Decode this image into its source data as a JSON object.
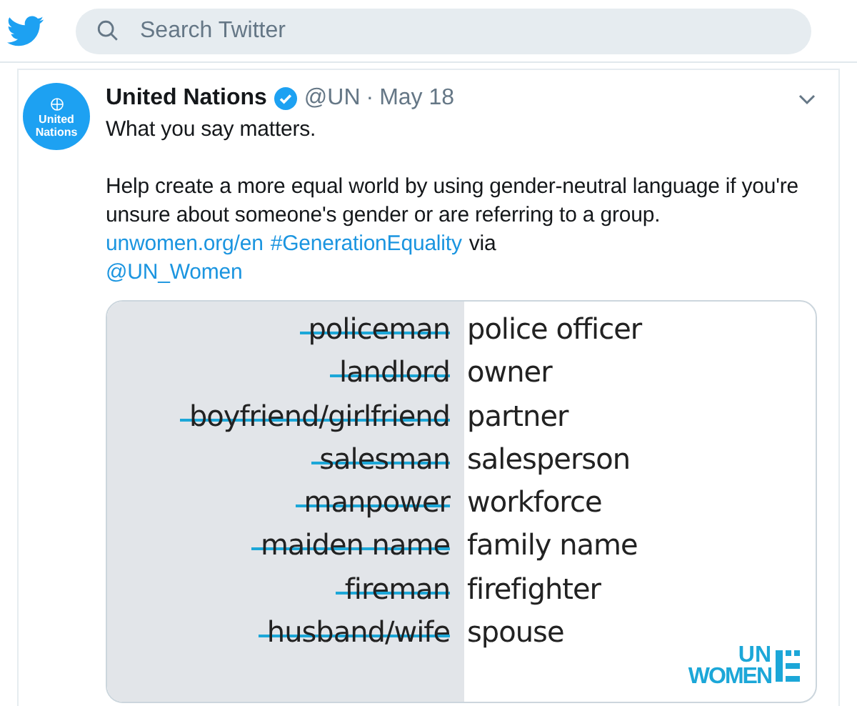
{
  "search": {
    "placeholder": "Search Twitter"
  },
  "tweet": {
    "avatar_text": "United Nations",
    "name": "United Nations",
    "verified": true,
    "handle": "@UN",
    "separator": "·",
    "date": "May 18",
    "lines": [
      "What you say matters.",
      "Help create a more equal world by using gender-neutral language if you're unsure about someone's gender or are referring to a group."
    ],
    "link": "unwomen.org/en",
    "hashtag": "#GenerationEquality",
    "via": "via",
    "mention": "@UN_Women",
    "image": {
      "pairs": [
        {
          "avoid": "policeman",
          "use": "police officer"
        },
        {
          "avoid": "landlord",
          "use": "owner"
        },
        {
          "avoid": "boyfriend/girlfriend",
          "use": "partner"
        },
        {
          "avoid": "salesman",
          "use": "salesperson"
        },
        {
          "avoid": "manpower",
          "use": "workforce"
        },
        {
          "avoid": "maiden name",
          "use": "family name"
        },
        {
          "avoid": "fireman",
          "use": "firefighter"
        },
        {
          "avoid": "husband/wife",
          "use": "spouse"
        }
      ],
      "logo": [
        "UN",
        "WOMEN"
      ]
    }
  }
}
